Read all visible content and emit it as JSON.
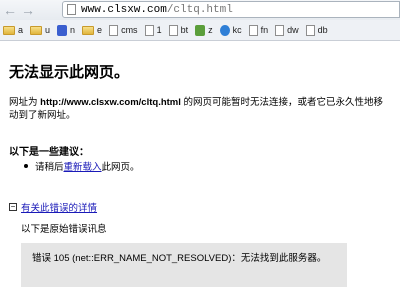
{
  "toolbar": {
    "back_glyph": "←",
    "forward_glyph": "→",
    "url_host": "www.clsxw.com",
    "url_path": "/cltq.html"
  },
  "bookmarks": [
    {
      "label": "a",
      "icon": "folder-icon"
    },
    {
      "label": "u",
      "icon": "folder-icon"
    },
    {
      "label": "n",
      "icon": "baidu-paw-icon"
    },
    {
      "label": "e",
      "icon": "folder-icon"
    },
    {
      "label": "cms",
      "icon": "document-icon"
    },
    {
      "label": "1",
      "icon": "document-icon"
    },
    {
      "label": "bt",
      "icon": "document-icon"
    },
    {
      "label": "z",
      "icon": "chart-icon"
    },
    {
      "label": "kc",
      "icon": "globe-icon"
    },
    {
      "label": "fn",
      "icon": "document-icon"
    },
    {
      "label": "dw",
      "icon": "document-icon"
    },
    {
      "label": "db",
      "icon": "document-icon"
    }
  ],
  "page": {
    "title": "无法显示此网页。",
    "desc_prefix": "网址为 ",
    "desc_url": "http://www.clsxw.com/cltq.html",
    "desc_suffix": " 的网页可能暂时无法连接，或者它已永久性地移动到了新网址。",
    "suggest_heading": "以下是一些建议：",
    "suggest_pre": "请稍后",
    "suggest_link": "重新载入",
    "suggest_post": "此网页。",
    "details_toggle_symbol": "−",
    "details_link": "有关此错误的详情",
    "details_sub": "以下是原始错误讯息",
    "error_text": "错误 105 (net::ERR_NAME_NOT_RESOLVED)：无法找到此服务器。"
  }
}
